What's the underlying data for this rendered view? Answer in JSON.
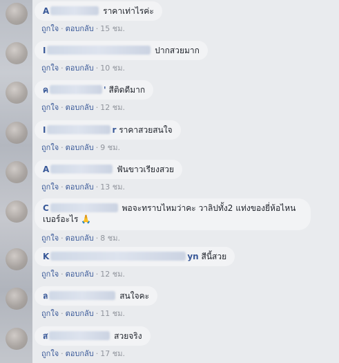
{
  "comments": [
    {
      "name_prefix": "A",
      "name_suffix": "",
      "text": "ราคาเท่าไรค่ะ",
      "time": "15 ชม."
    },
    {
      "name_prefix": "I",
      "name_suffix": "",
      "text": "ปากสวยมาก",
      "time": "10 ชม."
    },
    {
      "name_prefix": "ค",
      "name_suffix": "'",
      "text": "สีติดดีมาก",
      "time": "12 ชม."
    },
    {
      "name_prefix": "I",
      "name_suffix": "r",
      "text": "ราคาสวยสนใจ",
      "time": "9 ชม."
    },
    {
      "name_prefix": "A",
      "name_suffix": "",
      "text": "ฟันขาวเรียงสวย",
      "time": "13 ชม."
    },
    {
      "name_prefix": "C",
      "name_suffix": "",
      "text": "พอจะทราบไหมว่าคะ วาลิปทั้ง2 แท่งของยี่ห้อไหน เบอร์อะไร",
      "emoji": "🙏",
      "time": "8 ชม."
    },
    {
      "name_prefix": "K",
      "name_suffix": "yn",
      "text": "สีนี้สวย",
      "time": "12 ชม."
    },
    {
      "name_prefix": "ล",
      "name_suffix": "",
      "text": "สนใจคะ",
      "time": "11 ชม."
    },
    {
      "name_prefix": "ส",
      "name_suffix": "",
      "text": "สวยจริง",
      "time": "17 ชม."
    }
  ],
  "actions": {
    "like": "ถูกใจ",
    "reply": "ตอบกลับ",
    "separator": "·"
  }
}
